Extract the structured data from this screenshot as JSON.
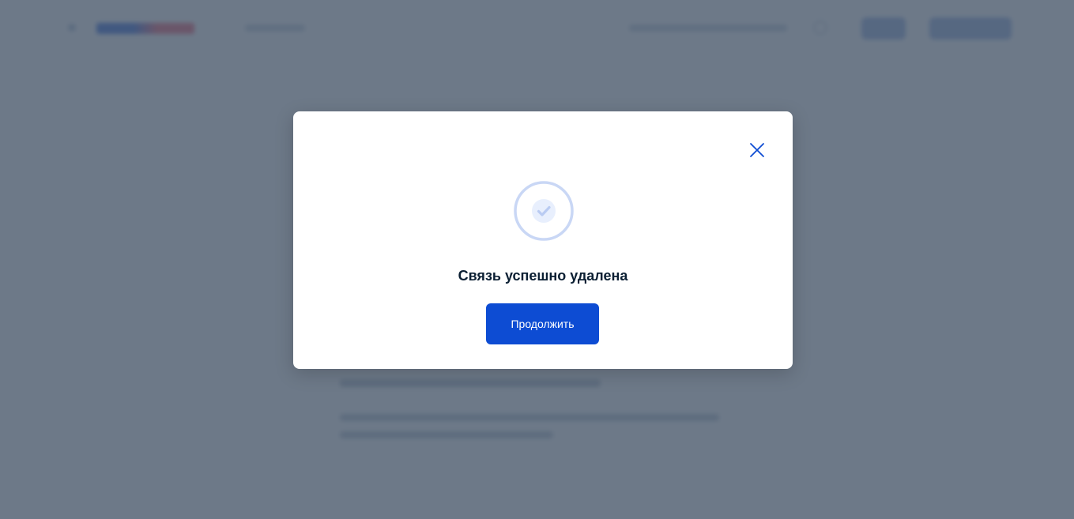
{
  "modal": {
    "title": "Связь успешно удалена",
    "continue_label": "Продолжить",
    "close_icon": "close-icon",
    "status_icon": "check-circle-icon"
  },
  "colors": {
    "accent": "#0d4cd3",
    "icon_ring": "#c9d7f5",
    "icon_fill": "#e8effd",
    "title_text": "#0b1f33",
    "overlay": "#4d5c6e"
  }
}
